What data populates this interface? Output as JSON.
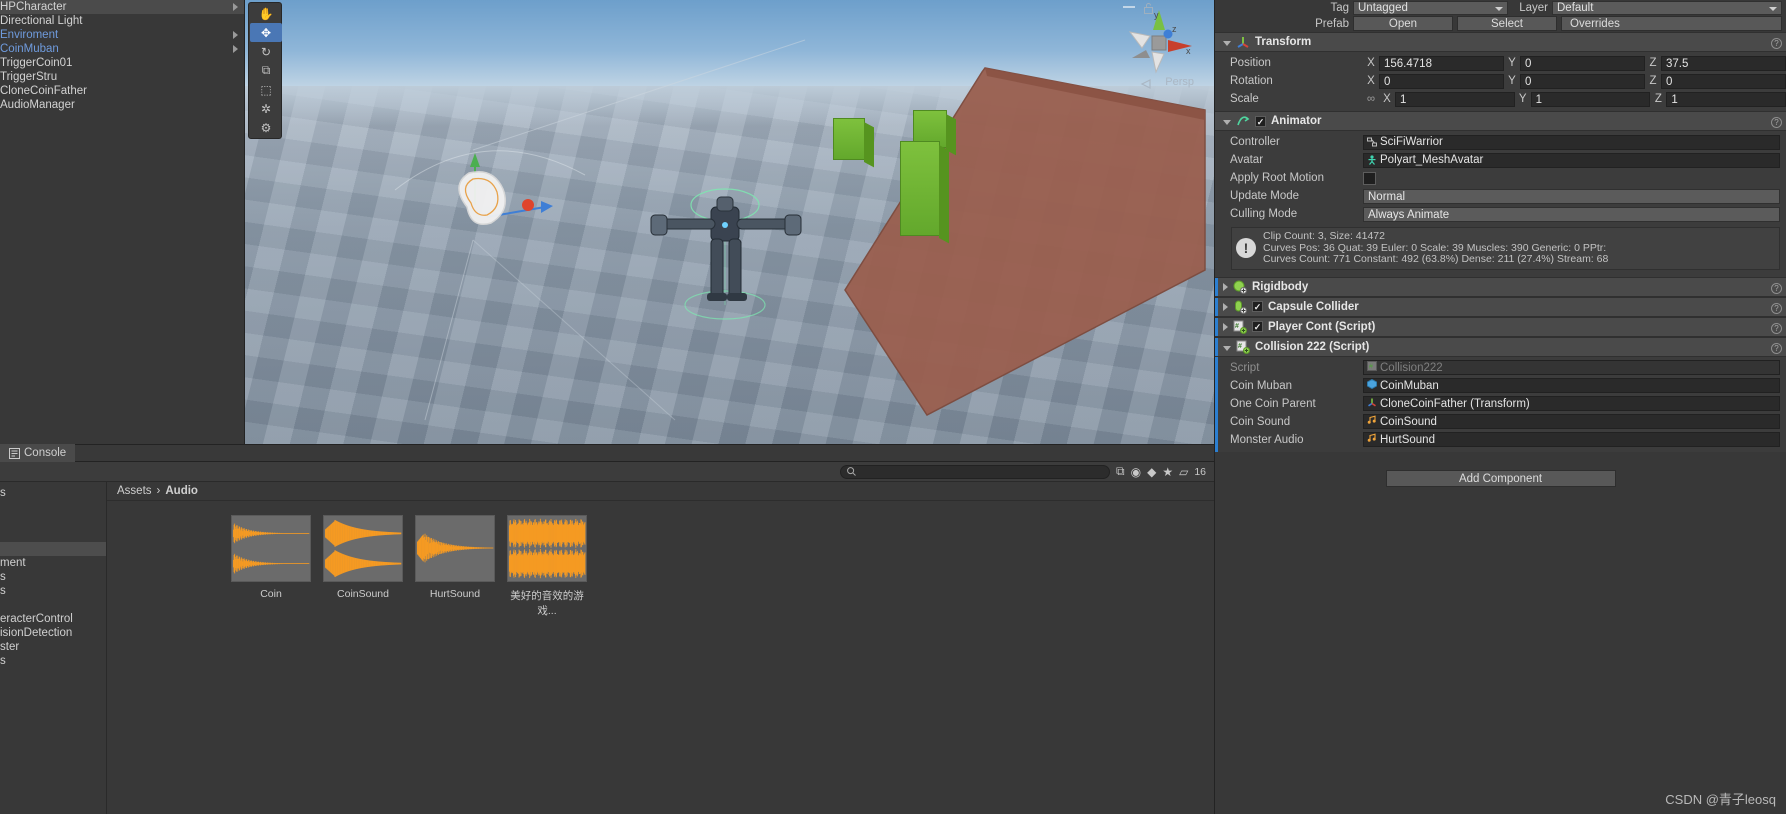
{
  "hierarchy": {
    "items": [
      {
        "label": "HPCharacter",
        "selected": true,
        "prefab": false,
        "expandable": true
      },
      {
        "label": "Directional Light",
        "selected": false,
        "prefab": false,
        "expandable": false
      },
      {
        "label": "Enviroment",
        "selected": false,
        "prefab": true,
        "expandable": true
      },
      {
        "label": "CoinMuban",
        "selected": false,
        "prefab": true,
        "expandable": true
      },
      {
        "label": "TriggerCoin01",
        "selected": false,
        "prefab": false,
        "expandable": false
      },
      {
        "label": "TriggerStru",
        "selected": false,
        "prefab": false,
        "expandable": false
      },
      {
        "label": "CloneCoinFather",
        "selected": false,
        "prefab": false,
        "expandable": false
      },
      {
        "label": "AudioManager",
        "selected": false,
        "prefab": false,
        "expandable": false
      }
    ]
  },
  "scene": {
    "persp_label": "Persp",
    "gizmo_axes": [
      "y",
      "z",
      "x"
    ],
    "tools": [
      {
        "name": "hand-tool",
        "glyph": "✋",
        "active": false
      },
      {
        "name": "move-tool",
        "glyph": "✥",
        "active": true
      },
      {
        "name": "rotate-tool",
        "glyph": "↻",
        "active": false
      },
      {
        "name": "scale-tool",
        "glyph": "⧉",
        "active": false
      },
      {
        "name": "rect-tool",
        "glyph": "⬚",
        "active": false
      },
      {
        "name": "transform-tool",
        "glyph": "✲",
        "active": false
      },
      {
        "name": "custom-tool",
        "glyph": "⚙",
        "active": false
      }
    ]
  },
  "inspector": {
    "tag_label": "Tag",
    "tag_value": "Untagged",
    "layer_label": "Layer",
    "layer_value": "Default",
    "prefab_label": "Prefab",
    "prefab_open": "Open",
    "prefab_select": "Select",
    "prefab_overrides": "Overrides",
    "transform": {
      "title": "Transform",
      "rows": [
        {
          "label": "Position",
          "x": "156.4718",
          "y": "0",
          "z": "37.5"
        },
        {
          "label": "Rotation",
          "x": "0",
          "y": "0",
          "z": "0"
        },
        {
          "label": "Scale",
          "x": "1",
          "y": "1",
          "z": "1"
        }
      ]
    },
    "animator": {
      "title": "Animator",
      "enabled": true,
      "controller_label": "Controller",
      "controller_value": "SciFiWarrior",
      "avatar_label": "Avatar",
      "avatar_value": "Polyart_MeshAvatar",
      "apply_root_motion_label": "Apply Root Motion",
      "apply_root_motion_value": false,
      "update_mode_label": "Update Mode",
      "update_mode_value": "Normal",
      "culling_mode_label": "Culling Mode",
      "culling_mode_value": "Always Animate",
      "info_line1": "Clip Count: 3, Size: 41472",
      "info_line2": "Curves Pos: 36 Quat: 39 Euler: 0 Scale: 39 Muscles: 390 Generic: 0 PPtr:",
      "info_line3": "Curves Count: 771 Constant: 492 (63.8%) Dense: 211 (27.4%) Stream: 68"
    },
    "components": [
      {
        "title": "Rigidbody",
        "has_checkbox": false,
        "checked": false,
        "expanded": false,
        "icon": "rigidbody-icon"
      },
      {
        "title": "Capsule Collider",
        "has_checkbox": true,
        "checked": true,
        "expanded": false,
        "icon": "capsule-collider-icon"
      },
      {
        "title": "Player Cont (Script)",
        "has_checkbox": true,
        "checked": true,
        "expanded": false,
        "icon": "script-icon"
      },
      {
        "title": "Collision 222 (Script)",
        "has_checkbox": false,
        "checked": false,
        "expanded": true,
        "icon": "script-icon"
      }
    ],
    "collision222": {
      "rows": [
        {
          "label": "Script",
          "value": "Collision222",
          "icon": "script-asset-icon",
          "dim": true
        },
        {
          "label": "Coin Muban",
          "value": "CoinMuban",
          "icon": "prefab-icon",
          "dim": false
        },
        {
          "label": "One Coin Parent",
          "value": "CloneCoinFather (Transform)",
          "icon": "transform-icon",
          "dim": false
        },
        {
          "label": "Coin Sound",
          "value": "CoinSound",
          "icon": "audio-icon",
          "dim": false
        },
        {
          "label": "Monster Audio",
          "value": "HurtSound",
          "icon": "audio-icon",
          "dim": false
        }
      ]
    },
    "add_component_label": "Add Component"
  },
  "console": {
    "tab_label": "Console",
    "tab_icon": "console-icon"
  },
  "project": {
    "search_placeholder": "",
    "search_value": "",
    "counter_label": "16",
    "toolbar_icons": [
      {
        "name": "save-search-icon",
        "glyph": "⧉"
      },
      {
        "name": "filter-type-icon",
        "glyph": "◉"
      },
      {
        "name": "filter-label-icon",
        "glyph": "◆"
      },
      {
        "name": "favorite-icon",
        "glyph": "★"
      },
      {
        "name": "zoom-slider-icon",
        "glyph": "▱"
      }
    ],
    "tree_items": [
      {
        "label": "s",
        "selected": false
      },
      {
        "label": "",
        "selected": false
      },
      {
        "label": "",
        "selected": false
      },
      {
        "label": "",
        "selected": false
      },
      {
        "label": "",
        "selected": true
      },
      {
        "label": "ment",
        "selected": false
      },
      {
        "label": "s",
        "selected": false
      },
      {
        "label": "s",
        "selected": false
      },
      {
        "label": "",
        "selected": false
      },
      {
        "label": "eracterControl",
        "selected": false
      },
      {
        "label": "isionDetection",
        "selected": false
      },
      {
        "label": "ster",
        "selected": false
      },
      {
        "label": "s",
        "selected": false
      }
    ],
    "breadcrumb": [
      "Assets",
      "Audio"
    ],
    "assets": [
      {
        "name": "Coin",
        "icon": "audio-waveform-icon",
        "style": "stereo-decay"
      },
      {
        "name": "CoinSound",
        "icon": "audio-waveform-icon",
        "style": "stereo-burst"
      },
      {
        "name": "HurtSound",
        "icon": "audio-waveform-icon",
        "style": "mono-decay"
      },
      {
        "name": "美好的音效的游戏...",
        "icon": "audio-waveform-icon",
        "style": "stereo-full"
      }
    ]
  },
  "watermark": {
    "text": "CSDN @青子leosq"
  },
  "colors": {
    "accent_blue": "#2c7fd1",
    "prefab_blue": "#6f9bdd",
    "waveform_orange": "#f59a23",
    "platform_brown": "#9a5f4f",
    "block_green": "#7ec13d"
  }
}
